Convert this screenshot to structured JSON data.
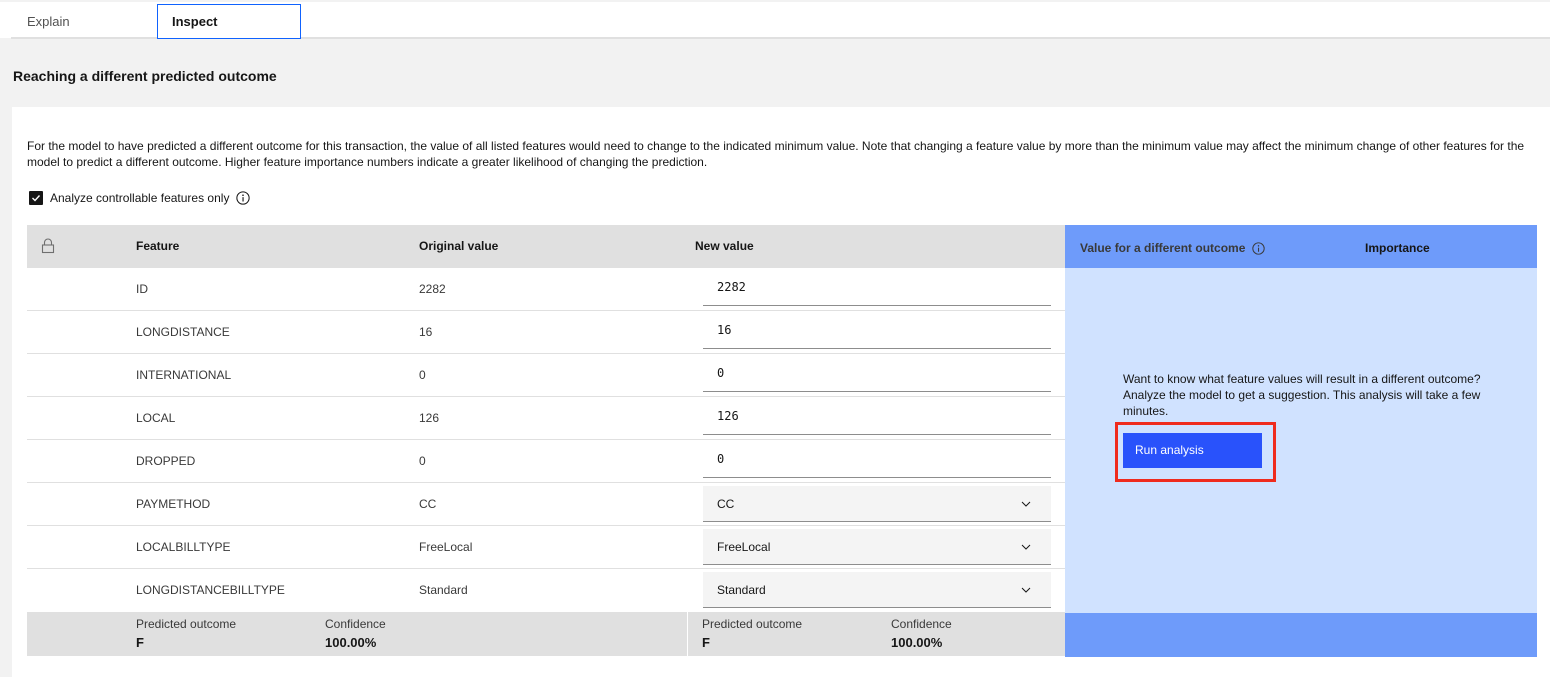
{
  "tabs": [
    {
      "label": "Explain",
      "active": false
    },
    {
      "label": "Inspect",
      "active": true
    }
  ],
  "section_title": "Reaching a different predicted outcome",
  "description": "For the model to have predicted a different outcome for this transaction, the value of all listed features would need to change to the indicated minimum value. Note that changing a feature value by more than the minimum value may affect the minimum change of other features for the model to predict a different outcome. Higher feature importance numbers indicate a greater likelihood of changing the prediction.",
  "controllable_checkbox": {
    "label": "Analyze controllable features only",
    "checked": true
  },
  "table": {
    "headers": {
      "lock": "lock-icon",
      "feature": "Feature",
      "original": "Original value",
      "new": "New value"
    },
    "rows": [
      {
        "feature": "ID",
        "original": "2282",
        "new": "2282",
        "input": "text"
      },
      {
        "feature": "LONGDISTANCE",
        "original": "16",
        "new": "16",
        "input": "text"
      },
      {
        "feature": "INTERNATIONAL",
        "original": "0",
        "new": "0",
        "input": "text"
      },
      {
        "feature": "LOCAL",
        "original": "126",
        "new": "126",
        "input": "text"
      },
      {
        "feature": "DROPPED",
        "original": "0",
        "new": "0",
        "input": "text"
      },
      {
        "feature": "PAYMETHOD",
        "original": "CC",
        "new": "CC",
        "input": "select"
      },
      {
        "feature": "LOCALBILLTYPE",
        "original": "FreeLocal",
        "new": "FreeLocal",
        "input": "select"
      },
      {
        "feature": "LONGDISTANCEBILLTYPE",
        "original": "Standard",
        "new": "Standard",
        "input": "select"
      }
    ],
    "footer": {
      "original": {
        "outcome_label": "Predicted outcome",
        "outcome": "F",
        "confidence_label": "Confidence",
        "confidence": "100.00%"
      },
      "new": {
        "outcome_label": "Predicted outcome",
        "outcome": "F",
        "confidence_label": "Confidence",
        "confidence": "100.00%"
      }
    }
  },
  "side_panel": {
    "header_value": "Value for a different outcome",
    "header_importance": "Importance",
    "message": "Want to know what feature values will result in a different outcome? Analyze the model to get a suggestion. This analysis will take a few minutes.",
    "run_button": "Run analysis"
  },
  "colors": {
    "accent": "#0f62fe",
    "button": "#2952fb",
    "side_bg": "#d0e2ff",
    "side_header": "#6e9bfa",
    "highlight": "#ef2b1e"
  }
}
